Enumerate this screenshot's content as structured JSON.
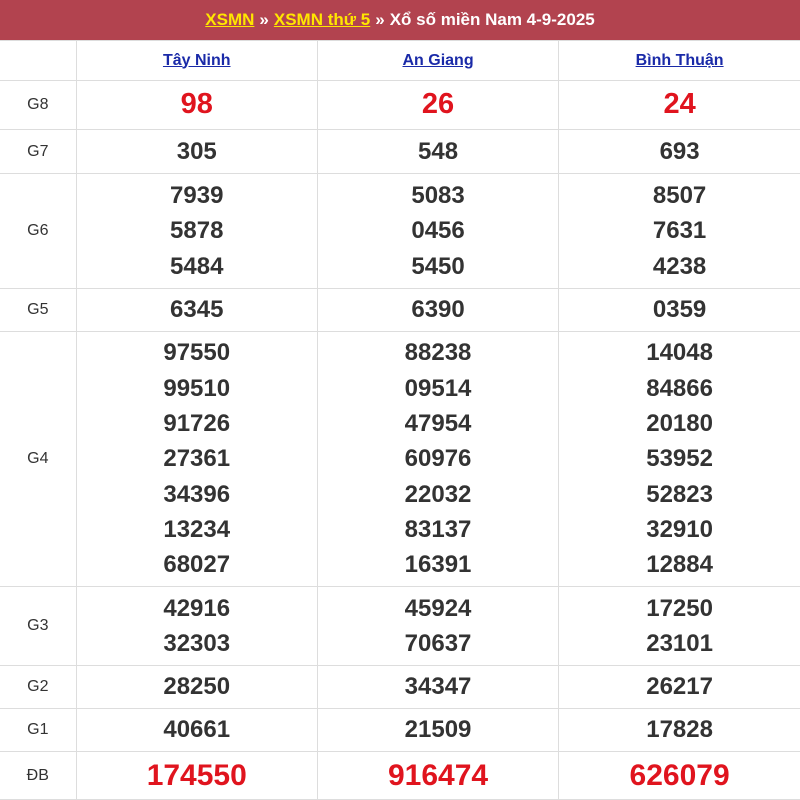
{
  "header": {
    "link1": "XSMN",
    "sep1": "»",
    "link2": "XSMN thứ 5",
    "sep2": "»",
    "title": "Xổ số miền Nam 4-9-2025"
  },
  "provinces": [
    "Tây Ninh",
    "An Giang",
    "Bình Thuận"
  ],
  "rows": [
    {
      "id": "g8",
      "label": "G8",
      "values": [
        [
          "98"
        ],
        [
          "26"
        ],
        [
          "24"
        ]
      ]
    },
    {
      "id": "g7",
      "label": "G7",
      "values": [
        [
          "305"
        ],
        [
          "548"
        ],
        [
          "693"
        ]
      ]
    },
    {
      "id": "g6",
      "label": "G6",
      "values": [
        [
          "7939",
          "5878",
          "5484"
        ],
        [
          "5083",
          "0456",
          "5450"
        ],
        [
          "8507",
          "7631",
          "4238"
        ]
      ]
    },
    {
      "id": "g5",
      "label": "G5",
      "values": [
        [
          "6345"
        ],
        [
          "6390"
        ],
        [
          "0359"
        ]
      ]
    },
    {
      "id": "g4",
      "label": "G4",
      "values": [
        [
          "97550",
          "99510",
          "91726",
          "27361",
          "34396",
          "13234",
          "68027"
        ],
        [
          "88238",
          "09514",
          "47954",
          "60976",
          "22032",
          "83137",
          "16391"
        ],
        [
          "14048",
          "84866",
          "20180",
          "53952",
          "52823",
          "32910",
          "12884"
        ]
      ]
    },
    {
      "id": "g3",
      "label": "G3",
      "values": [
        [
          "42916",
          "32303"
        ],
        [
          "45924",
          "70637"
        ],
        [
          "17250",
          "23101"
        ]
      ]
    },
    {
      "id": "g2",
      "label": "G2",
      "values": [
        [
          "28250"
        ],
        [
          "34347"
        ],
        [
          "26217"
        ]
      ]
    },
    {
      "id": "g1",
      "label": "G1",
      "values": [
        [
          "40661"
        ],
        [
          "21509"
        ],
        [
          "17828"
        ]
      ]
    },
    {
      "id": "db",
      "label": "ĐB",
      "values": [
        [
          "174550"
        ],
        [
          "916474"
        ],
        [
          "626079"
        ]
      ]
    }
  ],
  "colors": {
    "header_bg": "#b2434f",
    "link_yellow": "#ffe600",
    "province_blue": "#1a2aa8",
    "prize_red": "#e0141e",
    "text": "#333333"
  }
}
